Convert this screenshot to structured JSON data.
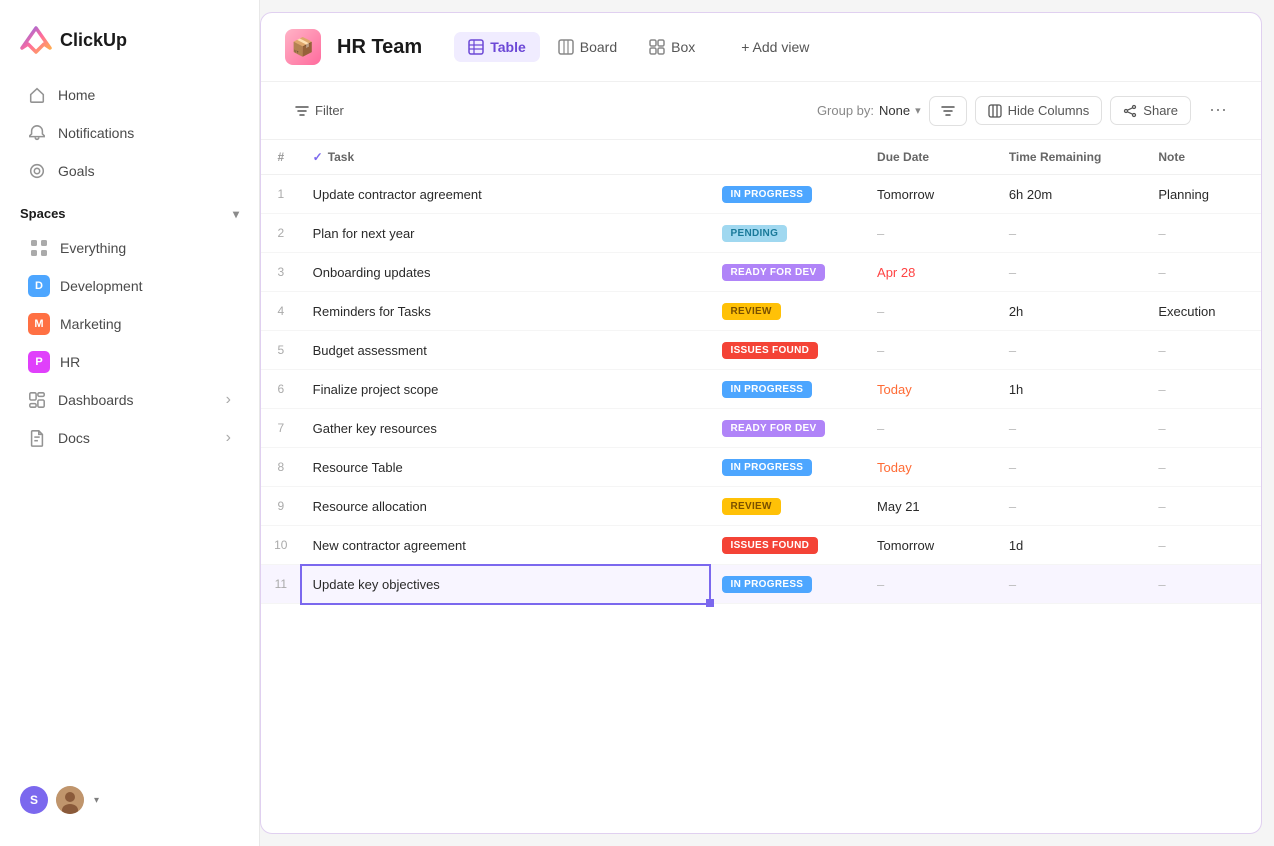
{
  "app": {
    "logo_text": "ClickUp"
  },
  "sidebar": {
    "nav_items": [
      {
        "id": "home",
        "label": "Home",
        "icon": "home"
      },
      {
        "id": "notifications",
        "label": "Notifications",
        "icon": "bell"
      },
      {
        "id": "goals",
        "label": "Goals",
        "icon": "target"
      }
    ],
    "spaces_label": "Spaces",
    "spaces_chevron": "▾",
    "everything_label": "Everything",
    "spaces": [
      {
        "id": "development",
        "label": "Development",
        "color": "#4da6ff",
        "initial": "D"
      },
      {
        "id": "marketing",
        "label": "Marketing",
        "color": "#ff7043",
        "initial": "M"
      },
      {
        "id": "hr",
        "label": "HR",
        "color": "#e040fb",
        "initial": "P"
      }
    ],
    "dashboards_label": "Dashboards",
    "docs_label": "Docs",
    "dashboards_chevron": "›",
    "docs_chevron": "›"
  },
  "workspace": {
    "icon": "📦",
    "title": "HR Team"
  },
  "views": [
    {
      "id": "table",
      "label": "Table",
      "icon": "grid",
      "active": true
    },
    {
      "id": "board",
      "label": "Board",
      "icon": "board",
      "active": false
    },
    {
      "id": "box",
      "label": "Box",
      "icon": "box",
      "active": false
    }
  ],
  "add_view_label": "+ Add view",
  "toolbar": {
    "filter_label": "Filter",
    "group_by_label": "Group by:",
    "group_by_value": "None",
    "sort_label": "Sort",
    "hide_columns_label": "Hide Columns",
    "share_label": "Share"
  },
  "table": {
    "columns": [
      "#",
      "Task",
      "",
      "Due Date",
      "Time Remaining",
      "Note"
    ],
    "rows": [
      {
        "num": 1,
        "task": "Update contractor agreement",
        "status": "IN PROGRESS",
        "status_class": "badge-in-progress",
        "due_date": "Tomorrow",
        "due_class": "due-date-normal",
        "time_remaining": "6h 20m",
        "note": "Planning"
      },
      {
        "num": 2,
        "task": "Plan for next year",
        "status": "PENDING",
        "status_class": "badge-pending",
        "due_date": "–",
        "due_class": "dash",
        "time_remaining": "–",
        "note": "–"
      },
      {
        "num": 3,
        "task": "Onboarding updates",
        "status": "READY FOR DEV",
        "status_class": "badge-ready-for-dev",
        "due_date": "Apr 28",
        "due_class": "due-date-overdue",
        "time_remaining": "–",
        "note": "–"
      },
      {
        "num": 4,
        "task": "Reminders for Tasks",
        "status": "REVIEW",
        "status_class": "badge-review",
        "due_date": "–",
        "due_class": "dash",
        "time_remaining": "2h",
        "note": "Execution"
      },
      {
        "num": 5,
        "task": "Budget assessment",
        "status": "ISSUES FOUND",
        "status_class": "badge-issues-found",
        "due_date": "–",
        "due_class": "dash",
        "time_remaining": "–",
        "note": "–"
      },
      {
        "num": 6,
        "task": "Finalize project scope",
        "status": "IN PROGRESS",
        "status_class": "badge-in-progress",
        "due_date": "Today",
        "due_class": "due-date-today",
        "time_remaining": "1h",
        "note": "–"
      },
      {
        "num": 7,
        "task": "Gather key resources",
        "status": "READY FOR DEV",
        "status_class": "badge-ready-for-dev",
        "due_date": "–",
        "due_class": "dash",
        "time_remaining": "–",
        "note": "–"
      },
      {
        "num": 8,
        "task": "Resource Table",
        "status": "IN PROGRESS",
        "status_class": "badge-in-progress",
        "due_date": "Today",
        "due_class": "due-date-today",
        "time_remaining": "–",
        "note": "–"
      },
      {
        "num": 9,
        "task": "Resource allocation",
        "status": "REVIEW",
        "status_class": "badge-review",
        "due_date": "May 21",
        "due_class": "due-date-normal",
        "time_remaining": "–",
        "note": "–"
      },
      {
        "num": 10,
        "task": "New contractor agreement",
        "status": "ISSUES FOUND",
        "status_class": "badge-issues-found",
        "due_date": "Tomorrow",
        "due_class": "due-date-normal",
        "time_remaining": "1d",
        "note": "–"
      },
      {
        "num": 11,
        "task": "Update key objectives",
        "status": "IN PROGRESS",
        "status_class": "badge-in-progress",
        "due_date": "–",
        "due_class": "dash",
        "time_remaining": "–",
        "note": "–"
      }
    ]
  },
  "user": {
    "initial": "S",
    "avatar_color": "#7b68ee"
  }
}
